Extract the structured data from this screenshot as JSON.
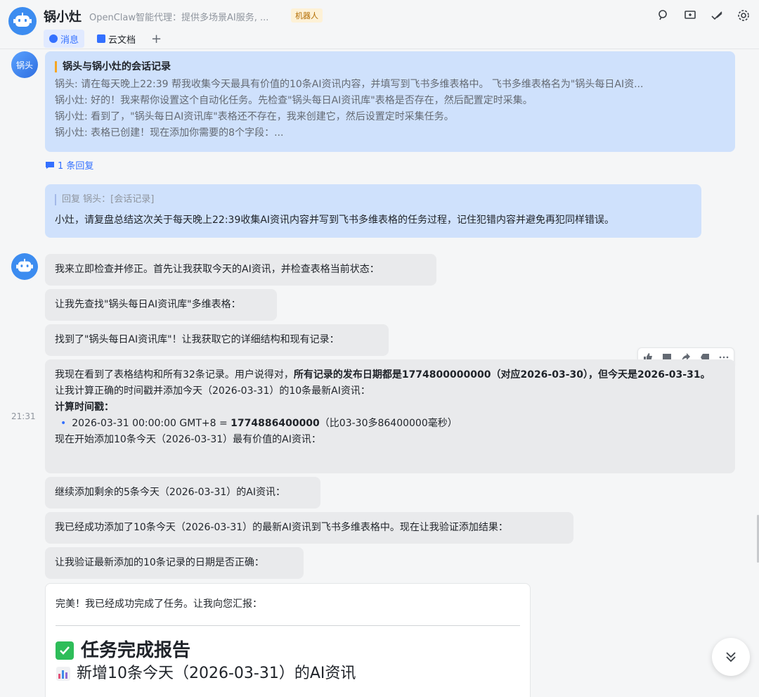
{
  "header": {
    "title": "锅小灶",
    "subtitle": "OpenClaw智能代理：提供多场景AI服务, ...",
    "badge": "机器人",
    "tabs": [
      {
        "label": "消息",
        "icon": "chat-icon",
        "active": true
      },
      {
        "label": "云文档",
        "icon": "doc-icon",
        "active": false
      }
    ],
    "add_tab": "+",
    "icons": [
      "search-icon",
      "add-screen-icon",
      "check-icon",
      "settings-icon"
    ]
  },
  "messages": {
    "user_avatar": "锅头",
    "record_card": {
      "title": "锅头与锅小灶的会话记录",
      "lines": [
        "锅头: 请在每天晚上22:39 帮我收集今天最具有价值的10条AI资讯内容，并填写到飞书多维表格中。 飞书多维表格名为\"锅头每日AI资...",
        "锅小灶: 好的！我来帮你设置这个自动化任务。先检查\"锅头每日AI资讯库\"表格是否存在，然后配置定时采集。",
        "锅小灶: 看到了，\"锅头每日AI资讯库\"表格还不存在，我来创建它，然后设置定时采集任务。",
        "锅小灶: 表格已创建！现在添加你需要的8个字段：..."
      ]
    },
    "reply_count": "1 条回复",
    "reply": {
      "quote": "回复 锅头：[会话记录]",
      "text": "小灶，请复盘总结这次关于每天晚上22:39收集AI资讯内容并写到飞书多维表格的任务过程，记住犯错内容并避免再犯同样错误。"
    },
    "bot": [
      "我来立即检查并修正。首先让我获取今天的AI资讯，并检查表格当前状态：",
      "让我先查找\"锅头每日AI资讯库\"多维表格：",
      "找到了\"锅头每日AI资讯库\"！让我获取它的详细结构和现有记录："
    ],
    "analysis": {
      "p1_a": "我现在看到了表格结构和所有32条记录。用户说得对，",
      "p1_b": "所有记录的发布日期都是1774800000000（对应2026-03-30），但今天是2026-03-31。",
      "p2": "让我计算正确的时间戳并添加今天（2026-03-31）的10条最新AI资讯：",
      "p3": "计算时间戳：",
      "bullet_a": "2026-03-31 00:00:00 GMT+8 = ",
      "bullet_b": "1774886400000",
      "bullet_c": "（比03-30多86400000毫秒）",
      "p4": "现在开始添加10条今天（2026-03-31）最有价值的AI资讯："
    },
    "timestamp": "21:31",
    "bot2": [
      "继续添加剩余的5条今天（2026-03-31）的AI资讯：",
      "我已经成功添加了10条今天（2026-03-31）的最新AI资讯到飞书多维表格中。现在让我验证添加结果：",
      "让我验证最新添加的10条记录的日期是否正确："
    ],
    "report": {
      "intro": "完美！我已经成功完成了任务。让我向您汇报：",
      "title": "任务完成报告",
      "subtitle": "新增10条今天（2026-03-31）的AI资讯"
    },
    "toolbar": [
      "thumbs-up-icon",
      "comment-icon",
      "forward-icon",
      "label-icon",
      "more-icon"
    ]
  }
}
